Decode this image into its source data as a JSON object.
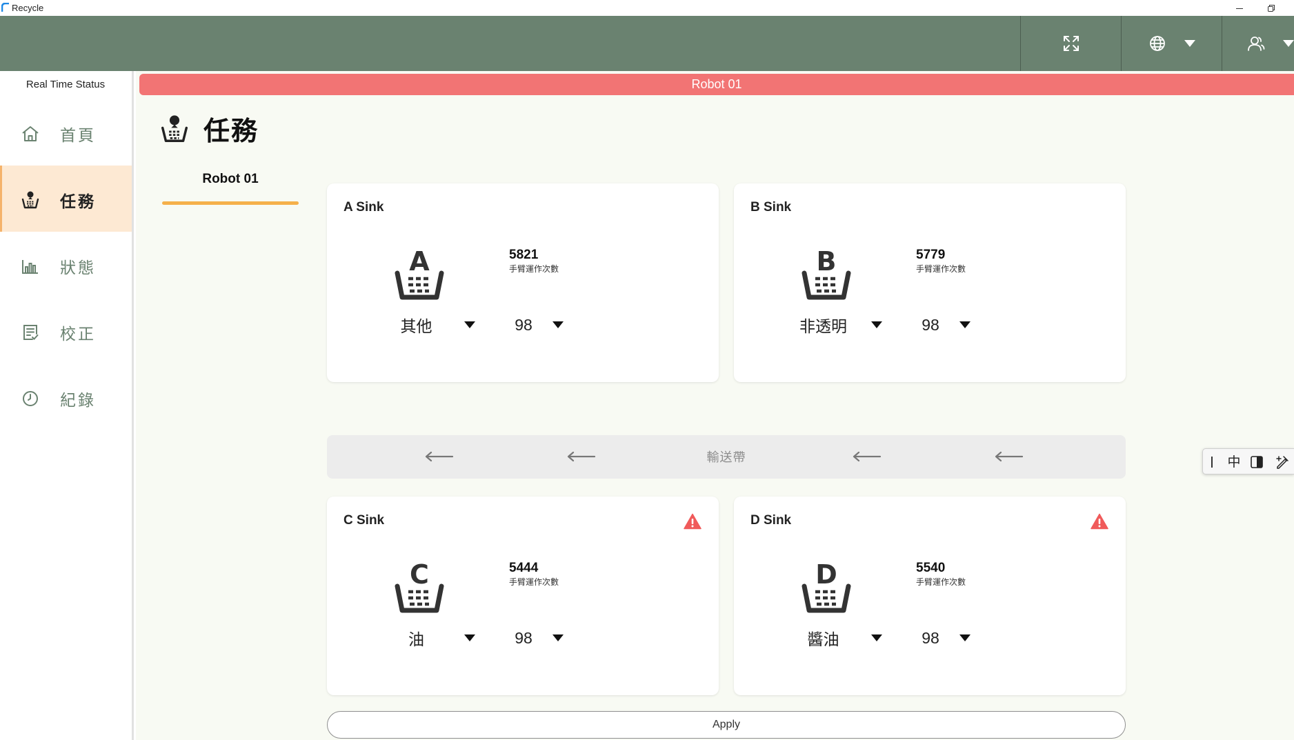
{
  "window": {
    "title": "Recycle"
  },
  "colors": {
    "header": "#6a8270",
    "banner": "#f27474",
    "active_nav_bg": "#fde9d3",
    "tab_underline": "#f5b04a",
    "warning": "#f05a5a",
    "main_bg": "#f8faf3"
  },
  "topbar": {
    "icons": [
      "fullscreen-icon",
      "globe-icon",
      "chevron-down-icon",
      "user-icon",
      "chevron-down-icon"
    ]
  },
  "sidebar": {
    "title": "Real Time Status",
    "items": [
      {
        "label": "首頁",
        "icon": "home-icon",
        "active": false
      },
      {
        "label": "任務",
        "icon": "basket-icon",
        "active": true
      },
      {
        "label": "狀態",
        "icon": "bar-chart-icon",
        "active": false
      },
      {
        "label": "校正",
        "icon": "checklist-icon",
        "active": false
      },
      {
        "label": "紀錄",
        "icon": "clock-icon",
        "active": false
      }
    ]
  },
  "main": {
    "banner": "Robot 01",
    "page_title": "任務",
    "tabs": [
      {
        "label": "Robot 01",
        "active": true
      }
    ],
    "sinks": [
      {
        "title": "A Sink",
        "letter": "A",
        "count": "5821",
        "count_label": "手臂運作次數",
        "type": "其他",
        "value": "98",
        "warning": false
      },
      {
        "title": "B Sink",
        "letter": "B",
        "count": "5779",
        "count_label": "手臂運作次數",
        "type": "非透明",
        "value": "98",
        "warning": false
      },
      {
        "title": "C Sink",
        "letter": "C",
        "count": "5444",
        "count_label": "手臂運作次數",
        "type": "油",
        "value": "98",
        "warning": true
      },
      {
        "title": "D Sink",
        "letter": "D",
        "count": "5540",
        "count_label": "手臂運作次數",
        "type": "醬油",
        "value": "98",
        "warning": true
      }
    ],
    "conveyor": {
      "label": "輸送帶",
      "direction": "left"
    },
    "apply_label": "Apply"
  },
  "ime": {
    "mode": "中"
  }
}
